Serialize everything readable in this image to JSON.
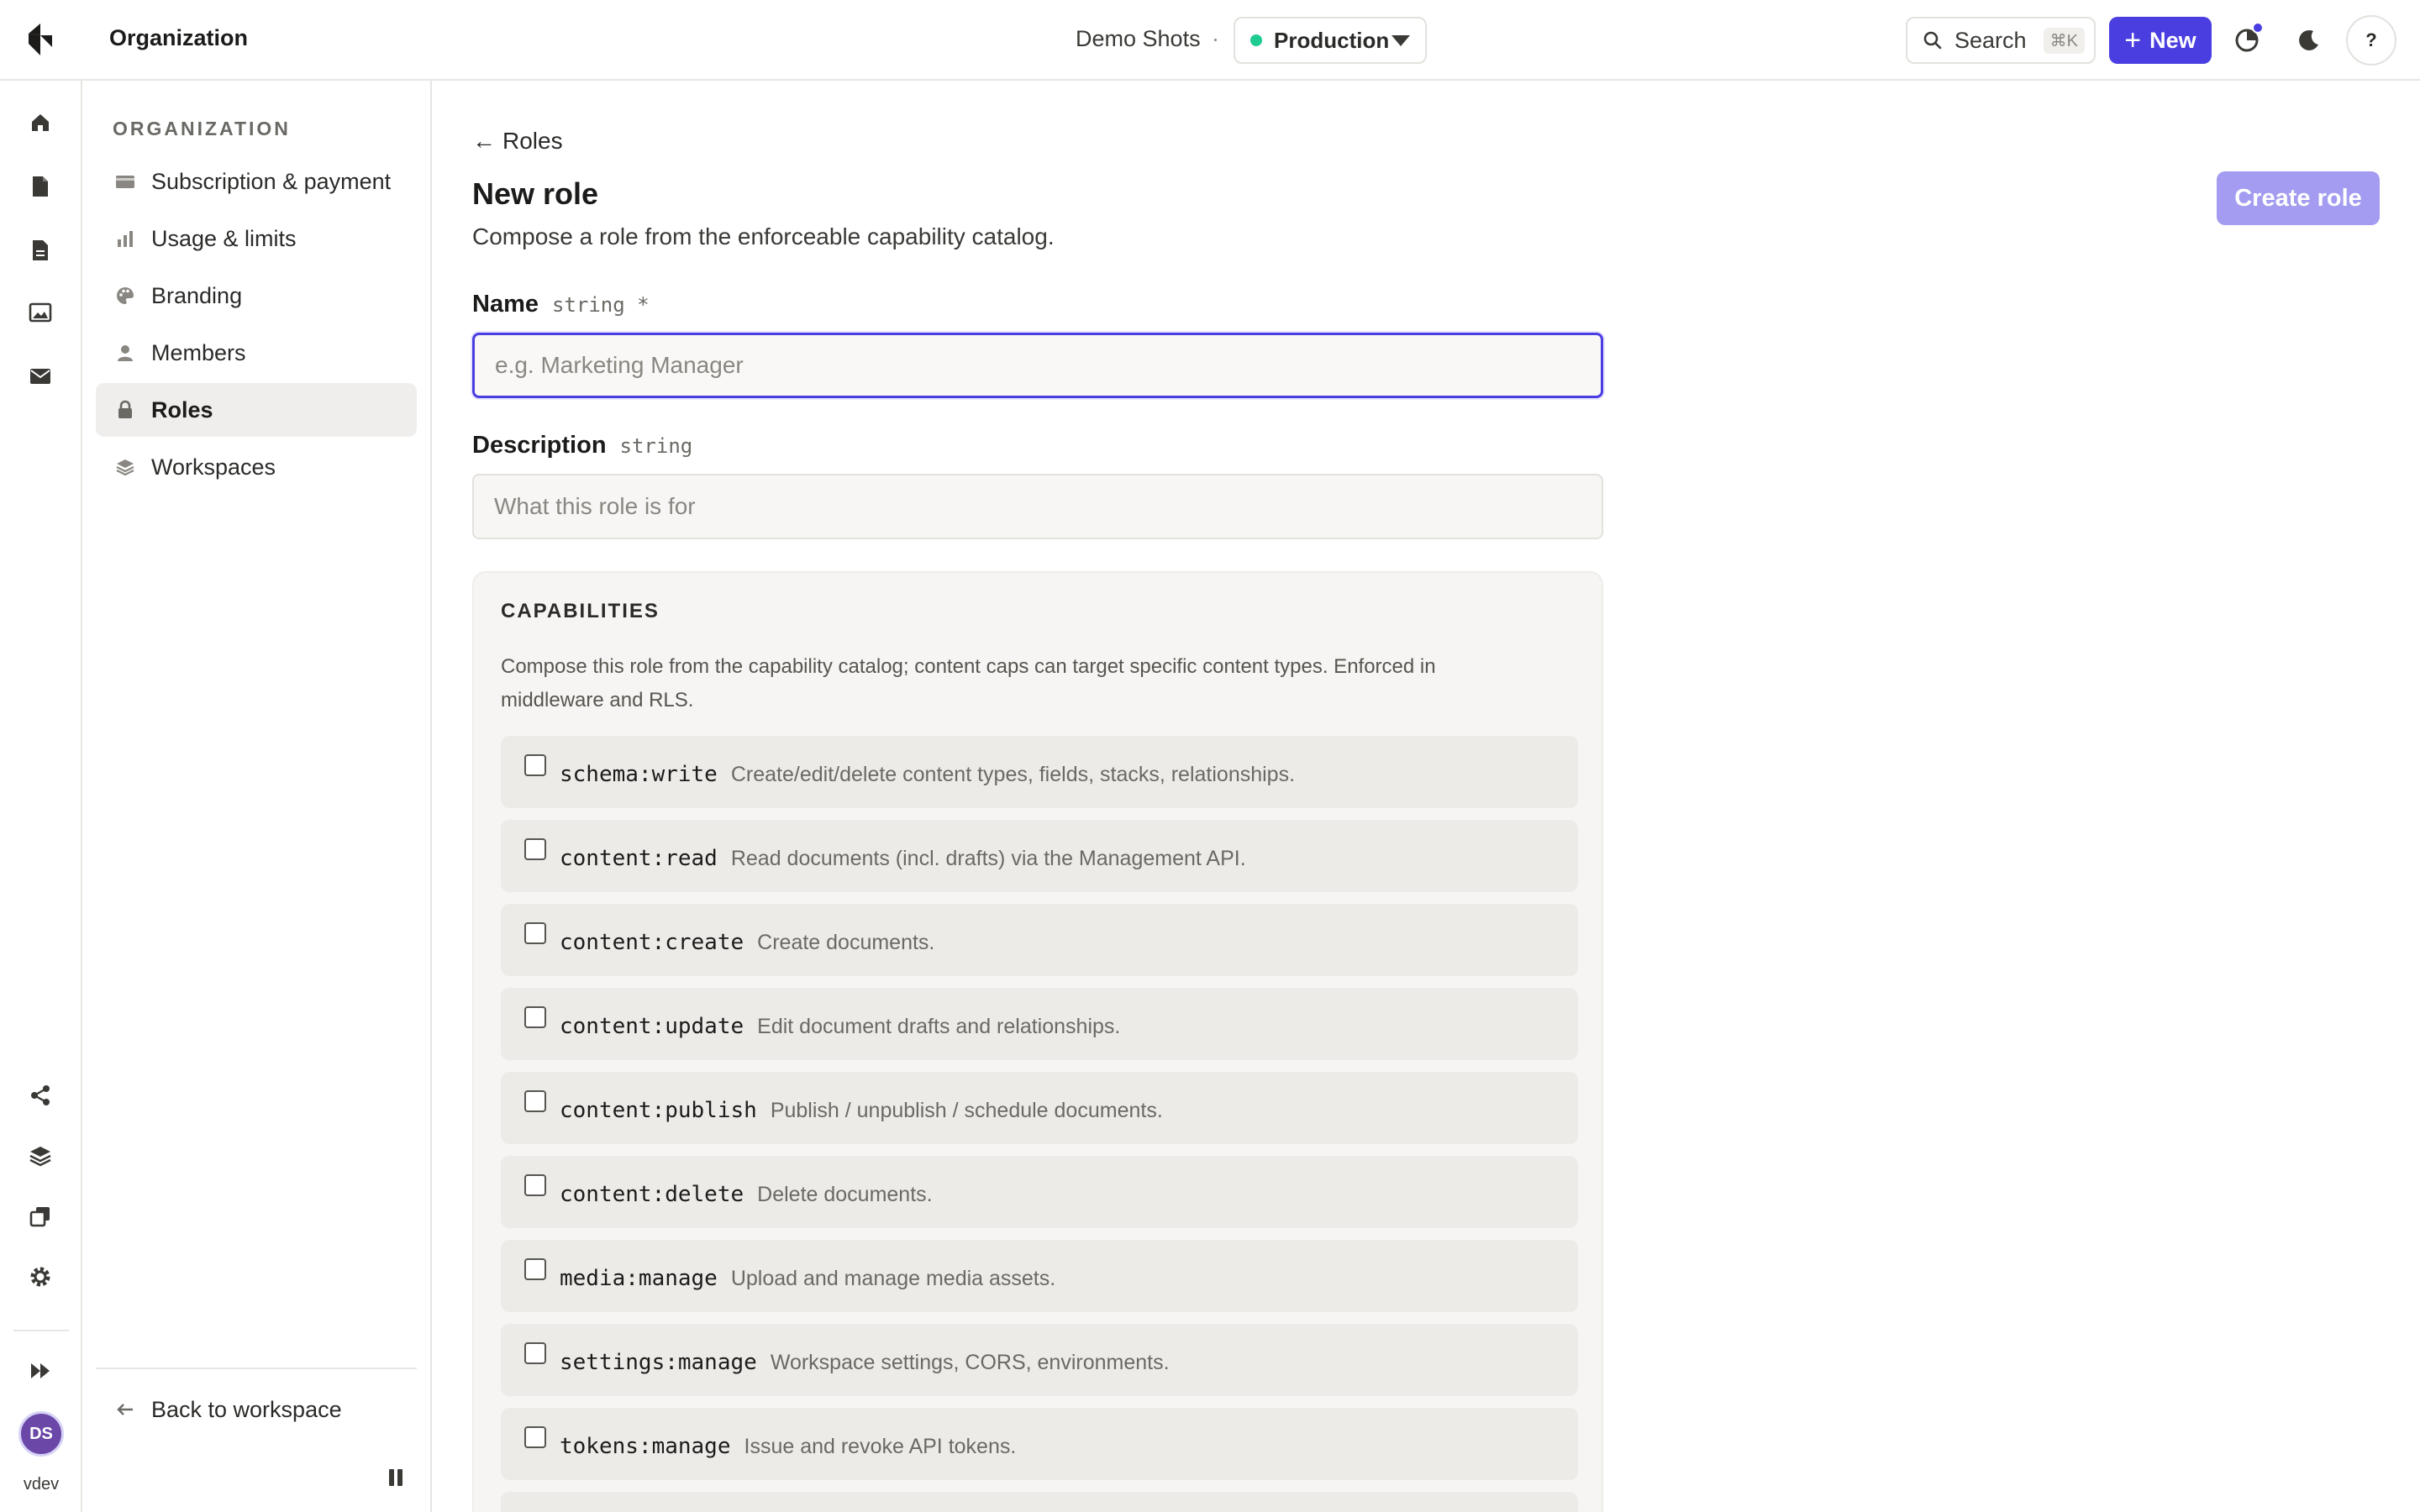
{
  "topbar": {
    "title": "Organization",
    "project": "Demo Shots",
    "separator": "·",
    "environment": "Production",
    "search_label": "Search",
    "search_shortcut": "⌘K",
    "new_label": "New",
    "help_label": "?"
  },
  "rail": {
    "user_initials": "DS",
    "user_label": "vdev"
  },
  "sidebar": {
    "heading": "ORGANIZATION",
    "items": [
      {
        "label": "Subscription & payment"
      },
      {
        "label": "Usage & limits"
      },
      {
        "label": "Branding"
      },
      {
        "label": "Members"
      },
      {
        "label": "Roles"
      },
      {
        "label": "Workspaces"
      }
    ],
    "back_label": "Back to workspace"
  },
  "main": {
    "back_label": "Roles",
    "title": "New role",
    "subtitle": "Compose a role from the enforceable capability catalog.",
    "create_label": "Create role",
    "name_field": {
      "label": "Name",
      "type": "string *",
      "value": "",
      "placeholder": "e.g. Marketing Manager"
    },
    "description_field": {
      "label": "Description",
      "type": "string",
      "value": "",
      "placeholder": "What this role is for"
    },
    "capabilities": {
      "heading": "CAPABILITIES",
      "description": "Compose this role from the capability catalog; content caps can target specific content types. Enforced in middleware and RLS.",
      "items": [
        {
          "code": "schema:write",
          "text": "Create/edit/delete content types, fields, stacks, relationships."
        },
        {
          "code": "content:read",
          "text": "Read documents (incl. drafts) via the Management API."
        },
        {
          "code": "content:create",
          "text": "Create documents."
        },
        {
          "code": "content:update",
          "text": "Edit document drafts and relationships."
        },
        {
          "code": "content:publish",
          "text": "Publish / unpublish / schedule documents."
        },
        {
          "code": "content:delete",
          "text": "Delete documents."
        },
        {
          "code": "media:manage",
          "text": "Upload and manage media assets."
        },
        {
          "code": "settings:manage",
          "text": "Workspace settings, CORS, environments."
        },
        {
          "code": "tokens:manage",
          "text": "Issue and revoke API tokens."
        }
      ]
    }
  },
  "colors": {
    "accent": "#4a3ee0",
    "accent_disabled": "#a39cf0",
    "environment_status": "#1fcc8f",
    "avatar": "#6b47a8"
  }
}
